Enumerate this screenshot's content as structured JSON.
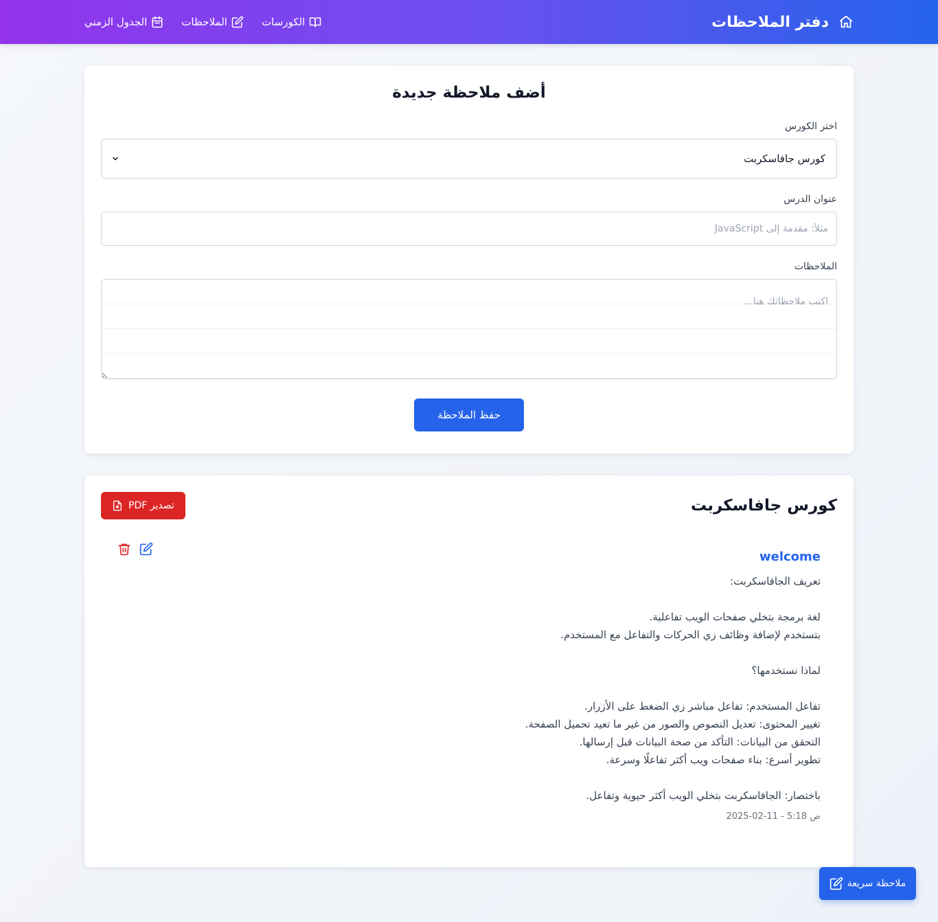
{
  "header": {
    "brand_title": "دفتر الملاحظات",
    "nav": {
      "courses": "الكورسات",
      "notes": "الملاحظات",
      "schedule": "الجدول الزمني"
    }
  },
  "form": {
    "title": "أضف ملاحظة جديدة",
    "course_label": "اختر الكورس",
    "course_selected": "كورس جافاسكربت",
    "lesson_label": "عنوان الدرس",
    "lesson_placeholder": "مثلاً: مقدمة إلى JavaScript",
    "notes_label": "الملاحظات",
    "notes_placeholder": "اكتب ملاحظاتك هنا...",
    "save_label": "حفظ الملاحظة"
  },
  "course_notes": {
    "course_title": "كورس جافاسكربت",
    "export_label": "تصدير PDF",
    "note": {
      "title": "welcome",
      "body": "تعريف الجافاسكربت:\n\nلغة برمجة بتخلي صفحات الويب تفاعلية.\nبتستخدم لإضافة وظائف زي الحركات والتفاعل مع المستخدم.\n\nلماذا نستخدمها؟\n\nتفاعل المستخدم: تفاعل مباشر زي الضغط على الأزرار.\nتغيير المحتوى: تعديل النصوص والصور من غير ما تعيد تحميل الصفحة.\nالتحقق من البيانات: التأكد من صحة البيانات قبل إرسالها.\nتطوير أسرع: بناء صفحات ويب أكثر تفاعلًا وسرعة.\n\nباختصار: الجافاسكربت بتخلي الويب أكثر حيوية وتفاعل.",
      "date": "2025-02-11 - 5:18 ص"
    }
  },
  "quick_note_label": "ملاحظة سريعة",
  "colors": {
    "primary": "#2563eb",
    "danger": "#dc2626",
    "header_gradient_start": "#9333ea",
    "header_gradient_end": "#2563eb"
  },
  "icons": [
    "home-icon",
    "book-open-icon",
    "edit-icon",
    "calendar-icon",
    "chevron-down-icon",
    "file-download-icon",
    "trash-icon"
  ]
}
